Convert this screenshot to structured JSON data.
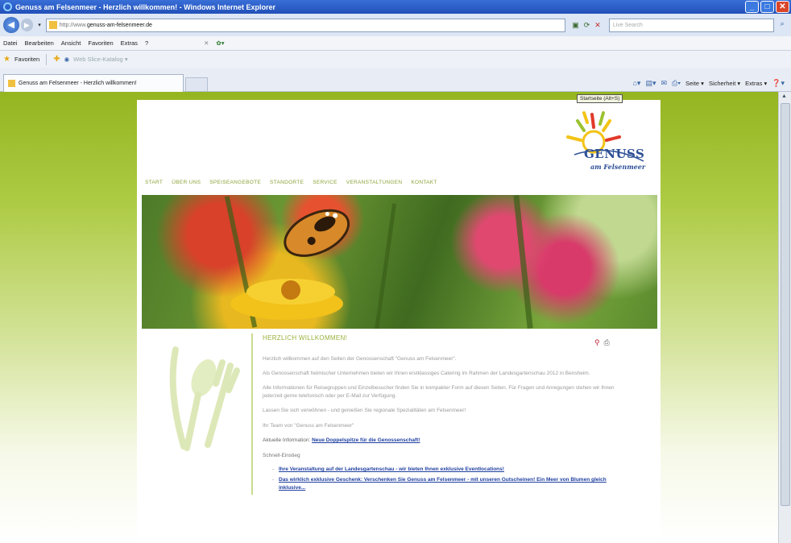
{
  "window": {
    "title": "Genuss am Felsenmeer - Herzlich willkommen! - Windows Internet Explorer",
    "controls": {
      "minimize": "_",
      "maximize": "□",
      "close": "✕"
    }
  },
  "address_bar": {
    "url_prefix": "http://www.",
    "url_domain": "genuss-am-felsenmeer.de",
    "search_placeholder": "Live Search"
  },
  "menu": {
    "items": [
      "Datei",
      "Bearbeiten",
      "Ansicht",
      "Favoriten",
      "Extras",
      "?"
    ]
  },
  "favorites_bar": {
    "label": "Favoriten",
    "gallery": "Web Slice-Katalog ▾"
  },
  "tab": {
    "label": "Genuss am Felsenmeer - Herzlich willkommen!"
  },
  "command_bar": {
    "items": [
      "Seite ▾",
      "Sicherheit ▾",
      "Extras ▾"
    ],
    "tooltip": "Startseite (Alt+S)"
  },
  "site": {
    "logo": {
      "word": "GENUSS",
      "sub": "am Felsenmeer"
    },
    "nav": [
      "START",
      "ÜBER UNS",
      "SPEISEANGEBOTE",
      "STANDORTE",
      "SERVICE",
      "VERANSTALTUNGEN",
      "KONTAKT"
    ],
    "heading": "HERZLICH WILLKOMMEN!",
    "paragraphs": [
      "Herzlich willkommen auf den Seiten der Genossenschaft \"Genuss am Felsenmeer\".",
      "Als Genossenschaft heimischer Unternehmen bieten wir Ihnen erstklassiges Catering im Rahmen der Landesgartenschau 2012 in Bensheim.",
      "Alle Informationen für Reisegruppen und Einzelbesucher finden Sie in kompakter Form auf diesen Seiten. Für Fragen und Anregungen stehen wir Ihnen jederzeit gerne telefonisch oder per E-Mail zur Verfügung.",
      "Lassen Sie sich verwöhnen - und genießen Sie regionale Spezialitäten am Felsenmeer!",
      "Ihr Team von \"Genuss am Felsenmeer\""
    ],
    "info_label": "Aktuelle Information:",
    "info_link": "Neue Doppelspitze für die Genossenschaft!",
    "quick_label": "Schnell-Einstieg",
    "quick_links": [
      "Ihre Veranstaltung auf der Landesgartenschau - wir bieten Ihnen exklusive Eventlocations!",
      "Das wirklich exklusive Geschenk: Verschenken Sie Genuss am Felsenmeer - mit unseren Gutscheinen! Ein Meer von Blumen gleich inklusive..."
    ]
  }
}
